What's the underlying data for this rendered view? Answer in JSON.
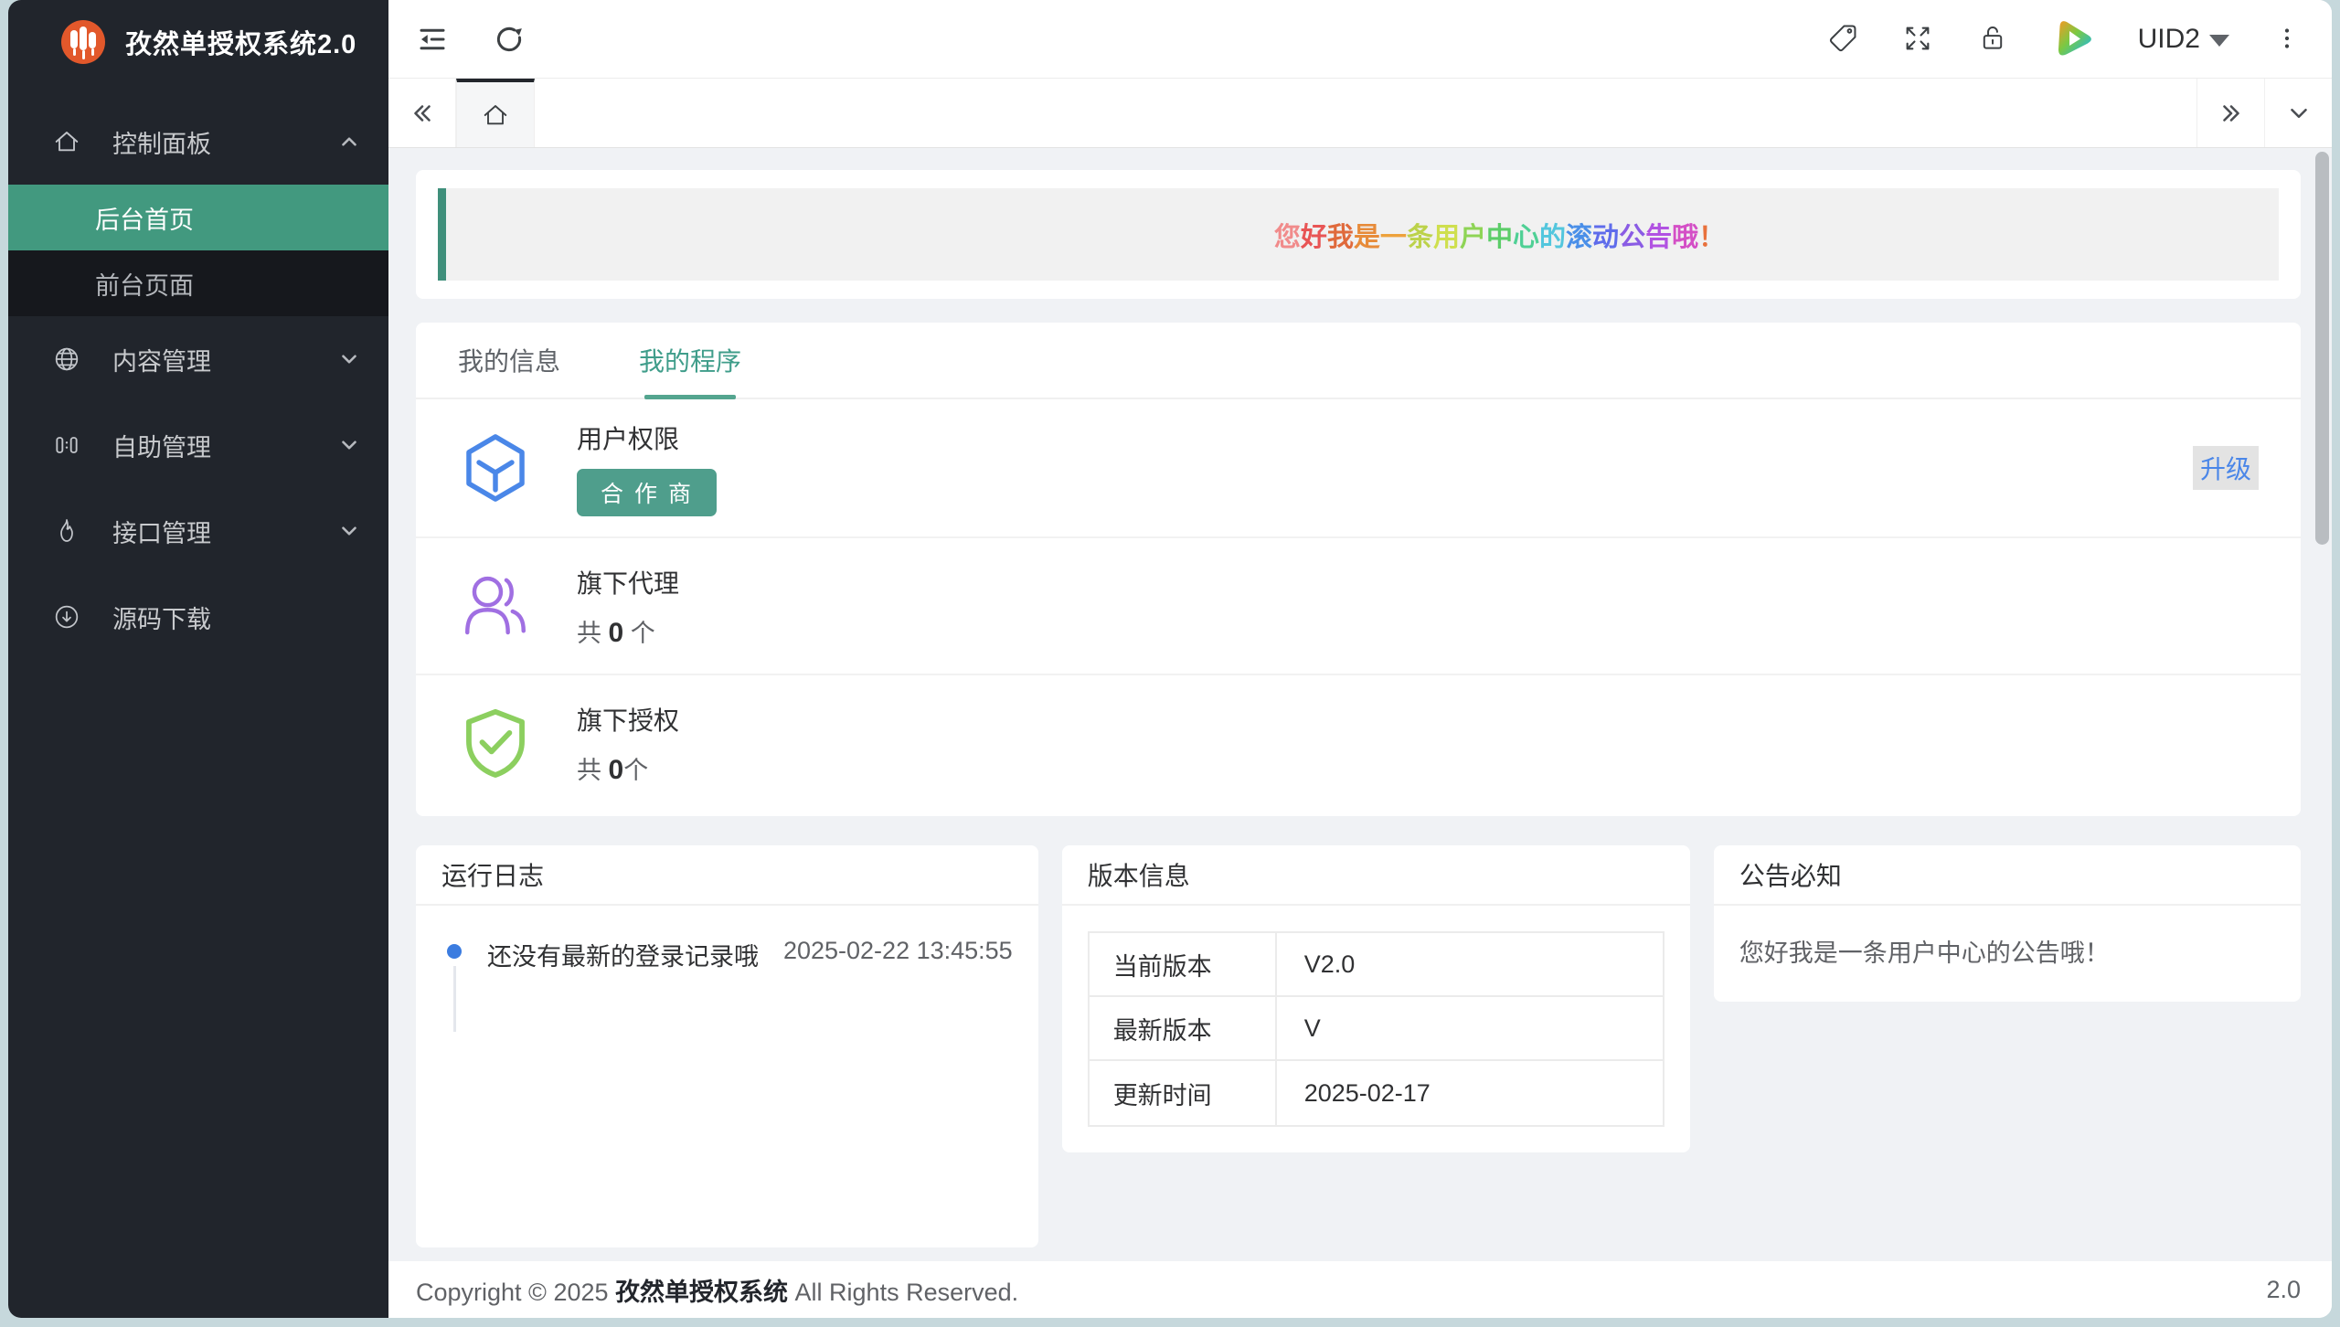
{
  "app": {
    "title": "孜然单授权系统2.0",
    "logo_color": "#e2582b",
    "accent_teal": "#42997f",
    "accent_blue": "#4a86e8"
  },
  "sidebar": {
    "menu": [
      {
        "label": "控制面板",
        "icon": "home-icon",
        "expanded": true
      },
      {
        "label": "后台首页",
        "active": true
      },
      {
        "label": "前台页面",
        "active": false
      },
      {
        "label": "内容管理",
        "icon": "globe-icon"
      },
      {
        "label": "自助管理",
        "icon": "columns-icon"
      },
      {
        "label": "接口管理",
        "icon": "flame-icon"
      },
      {
        "label": "源码下载",
        "icon": "download-icon"
      }
    ]
  },
  "topbar": {
    "user": "UID2"
  },
  "announcement": {
    "text": "您好我是一条用户中心的滚动公告哦！",
    "chars": [
      {
        "c": "您",
        "color": "#f18b8b"
      },
      {
        "c": "好",
        "color": "#e85555"
      },
      {
        "c": "我",
        "color": "#e06a3c"
      },
      {
        "c": "是",
        "color": "#e78b3a"
      },
      {
        "c": "一",
        "color": "#eda23c"
      },
      {
        "c": "条",
        "color": "#bcd24a"
      },
      {
        "c": "用",
        "color": "#cfdf4e"
      },
      {
        "c": "户",
        "color": "#8ed455"
      },
      {
        "c": "中",
        "color": "#5ccd68"
      },
      {
        "c": "心",
        "color": "#4fd095"
      },
      {
        "c": "的",
        "color": "#53c6dd"
      },
      {
        "c": "滚",
        "color": "#4a8fe8"
      },
      {
        "c": "动",
        "color": "#5f6ceb"
      },
      {
        "c": "公",
        "color": "#8a5ce4"
      },
      {
        "c": "告",
        "color": "#b152e2"
      },
      {
        "c": "哦",
        "color": "#d44fc6"
      },
      {
        "c": "！",
        "color": "#e8713c"
      }
    ]
  },
  "program": {
    "tabs": [
      {
        "label": "我的信息",
        "active": false
      },
      {
        "label": "我的程序",
        "active": true
      }
    ],
    "rows": [
      {
        "title": "用户权限",
        "badge": "合作商",
        "action": "升级"
      },
      {
        "title": "旗下代理",
        "count_pre": "共 ",
        "count": "0",
        "count_suf": " 个"
      },
      {
        "title": "旗下授权",
        "count_pre": "共 ",
        "count": "0",
        "count_suf": "个"
      }
    ]
  },
  "logs": {
    "title": "运行日志",
    "entry": "还没有最新的登录记录哦",
    "time": "2025-02-22 13:45:55"
  },
  "version": {
    "title": "版本信息",
    "rows": [
      {
        "label": "当前版本",
        "value": "V2.0"
      },
      {
        "label": "最新版本",
        "value": "V"
      },
      {
        "label": "更新时间",
        "value": "2025-02-17"
      }
    ]
  },
  "notice": {
    "title": "公告必知",
    "content": "您好我是一条用户中心的公告哦！"
  },
  "footer": {
    "left": "Copyright © 2025 ",
    "brand": "孜然单授权系统",
    "right": " All Rights Reserved.",
    "version": "2.0"
  }
}
